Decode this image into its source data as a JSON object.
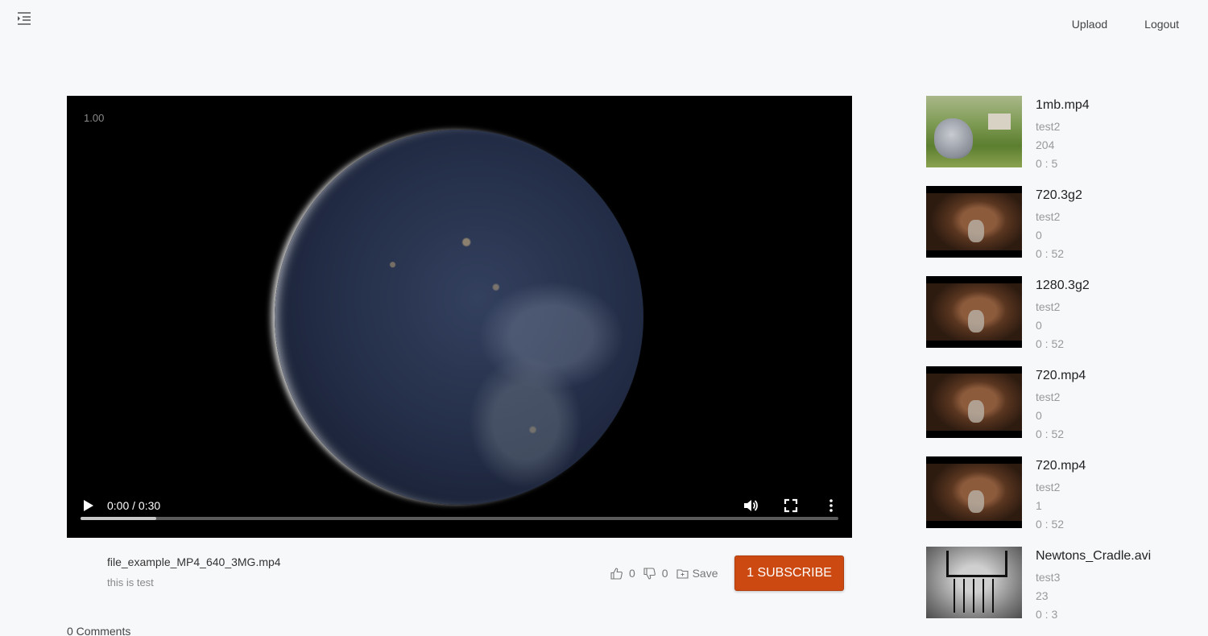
{
  "header": {
    "menu_icon": "menu-indent-icon",
    "nav": [
      "Uplaod",
      "Logout"
    ]
  },
  "player": {
    "playback_speed": "1.00",
    "time": "0:00 / 0:30",
    "buffered_fraction": 0.1,
    "icons": [
      "play-icon",
      "volume-icon",
      "fullscreen-icon",
      "more-options-icon"
    ]
  },
  "video": {
    "title": "file_example_MP4_640_3MG.mp4",
    "description": "this is test",
    "likes": "0",
    "dislikes": "0",
    "save_label": "Save",
    "subscribe_label": "1 SUBSCRIBE",
    "subscribe_color": "#cc4a12"
  },
  "comments": {
    "label": "0 Comments"
  },
  "sidebar": {
    "items": [
      {
        "title": "1mb.mp4",
        "user": "test2",
        "views": "204",
        "duration": "0 : 5",
        "thumb": "bunny"
      },
      {
        "title": "720.3g2",
        "user": "test2",
        "views": "0",
        "duration": "0 : 52",
        "thumb": "face"
      },
      {
        "title": "1280.3g2",
        "user": "test2",
        "views": "0",
        "duration": "0 : 52",
        "thumb": "face"
      },
      {
        "title": "720.mp4",
        "user": "test2",
        "views": "0",
        "duration": "0 : 52",
        "thumb": "face"
      },
      {
        "title": "720.mp4",
        "user": "test2",
        "views": "1",
        "duration": "0 : 52",
        "thumb": "face"
      },
      {
        "title": "Newtons_Cradle.avi",
        "user": "test3",
        "views": "23",
        "duration": "0 : 3",
        "thumb": "cradle"
      }
    ]
  }
}
